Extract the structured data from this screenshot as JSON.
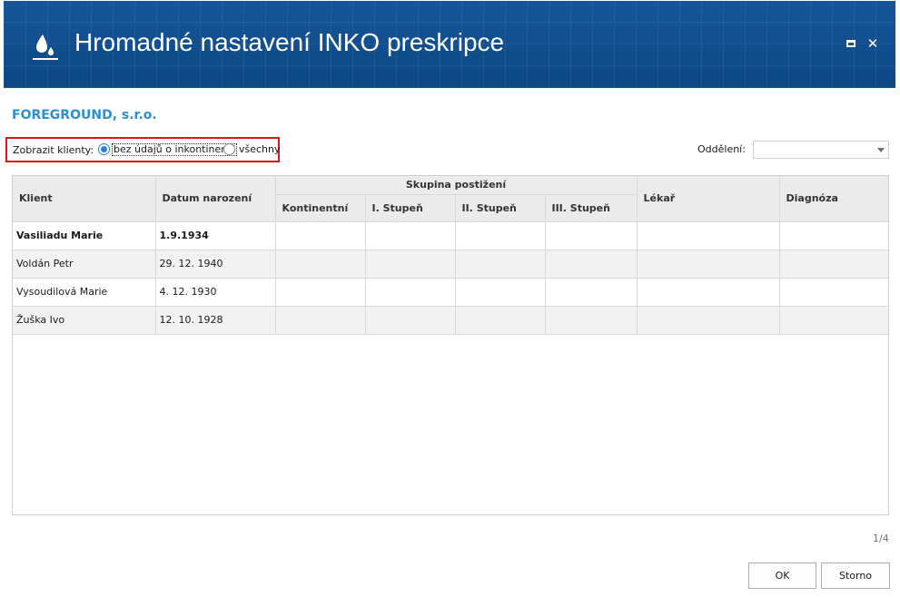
{
  "window": {
    "title": "Hromadné nastavení INKO preskripce",
    "icon": "water-drop-icon",
    "maximize_icon": "maximize-icon",
    "close_icon": "close-icon",
    "close_glyph": "✕"
  },
  "company": "FOREGROUND, s.r.o.",
  "filter": {
    "label": "Zobrazit klienty:",
    "options": [
      "bez údajů o inkontinenci",
      "všechny"
    ],
    "selected": 0
  },
  "department": {
    "label": "Oddělení:",
    "value": ""
  },
  "table": {
    "headers": {
      "client": "Klient",
      "birth": "Datum narození",
      "group": "Skupina postižení",
      "continent": "Kontinentní",
      "stage1": "I. Stupeň",
      "stage2": "II. Stupeň",
      "stage3": "III. Stupeň",
      "doctor": "Lékař",
      "diagnosis": "Diagnóza"
    },
    "rows": [
      {
        "client": "Vasiliadu Marie",
        "birth": "1.9.1934",
        "continent": "",
        "stage1": "",
        "stage2": "",
        "stage3": "",
        "doctor": "",
        "diagnosis": ""
      },
      {
        "client": "Voldán Petr",
        "birth": "29. 12. 1940",
        "continent": "",
        "stage1": "",
        "stage2": "",
        "stage3": "",
        "doctor": "",
        "diagnosis": ""
      },
      {
        "client": "Vysoudilová Marie",
        "birth": "4. 12. 1930",
        "continent": "",
        "stage1": "",
        "stage2": "",
        "stage3": "",
        "doctor": "",
        "diagnosis": ""
      },
      {
        "client": "Žuška Ivo",
        "birth": "12. 10. 1928",
        "continent": "",
        "stage1": "",
        "stage2": "",
        "stage3": "",
        "doctor": "",
        "diagnosis": ""
      }
    ]
  },
  "pager": "1/4",
  "buttons": {
    "ok": "OK",
    "cancel": "Storno"
  },
  "colors": {
    "titlebar": "#0f4d8a",
    "accent": "#2b8fd6",
    "highlight_border": "#e0141b"
  }
}
